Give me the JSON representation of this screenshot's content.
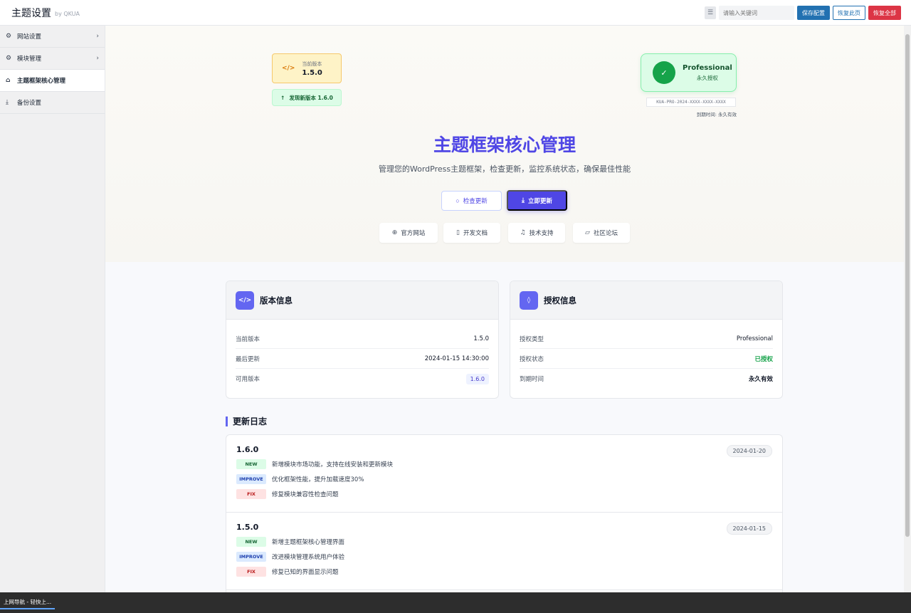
{
  "topbar": {
    "title": "主题设置",
    "by": "by QKUA",
    "search_placeholder": "请输入关键词",
    "save_label": "保存配置",
    "restore_label": "恢复此页",
    "reset_label": "恢复全部"
  },
  "sidebar": {
    "items": [
      {
        "label": "网站设置",
        "icon": "cogs-icon"
      },
      {
        "label": "模块管理",
        "icon": "cogs-icon"
      },
      {
        "label": "主题框架核心管理",
        "icon": "home-icon"
      },
      {
        "label": "备份设置",
        "icon": "download-icon"
      }
    ]
  },
  "hero": {
    "current_version_label": "当前版本",
    "current_version": "1.5.0",
    "new_version_label": "发现新版本 1.6.0",
    "license_name": "Professional",
    "license_sub": "永久授权",
    "license_key": "KUA-PRO-2024-XXXX-XXXX-XXXX",
    "license_expire": "到期时间: 永久有效",
    "title": "主题框架核心管理",
    "subtitle": "管理您的WordPress主题框架，检查更新，监控系统状态，确保最佳性能",
    "check_label": "检查更新",
    "update_label": "立即更新",
    "links": [
      "官方网站",
      "开发文档",
      "技术支持",
      "社区论坛"
    ]
  },
  "version_card": {
    "title": "版本信息",
    "rows": [
      {
        "k": "当前版本",
        "v": "1.5.0"
      },
      {
        "k": "最后更新",
        "v": "2024-01-15 14:30:00"
      },
      {
        "k": "可用版本",
        "v": "1.6.0"
      }
    ]
  },
  "license_card": {
    "title": "授权信息",
    "rows": [
      {
        "k": "授权类型",
        "v": "Professional"
      },
      {
        "k": "授权状态",
        "v": "已授权"
      },
      {
        "k": "到期时间",
        "v": "永久有效"
      }
    ]
  },
  "changelog": {
    "title": "更新日志",
    "entries": [
      {
        "version": "1.6.0",
        "date": "2024-01-20",
        "items": [
          {
            "tag": "NEW",
            "text": "新增模块市场功能，支持在线安装和更新模块"
          },
          {
            "tag": "IMPROVE",
            "text": "优化框架性能，提升加载速度30%"
          },
          {
            "tag": "FIX",
            "text": "修复模块兼容性检查问题"
          }
        ]
      },
      {
        "version": "1.5.0",
        "date": "2024-01-15",
        "items": [
          {
            "tag": "NEW",
            "text": "新增主题框架核心管理界面"
          },
          {
            "tag": "IMPROVE",
            "text": "改进模块管理系统用户体验"
          },
          {
            "tag": "FIX",
            "text": "修复已知的界面显示问题"
          }
        ]
      }
    ]
  },
  "taskbar": {
    "item": "上网导航 - 轻快上..."
  }
}
